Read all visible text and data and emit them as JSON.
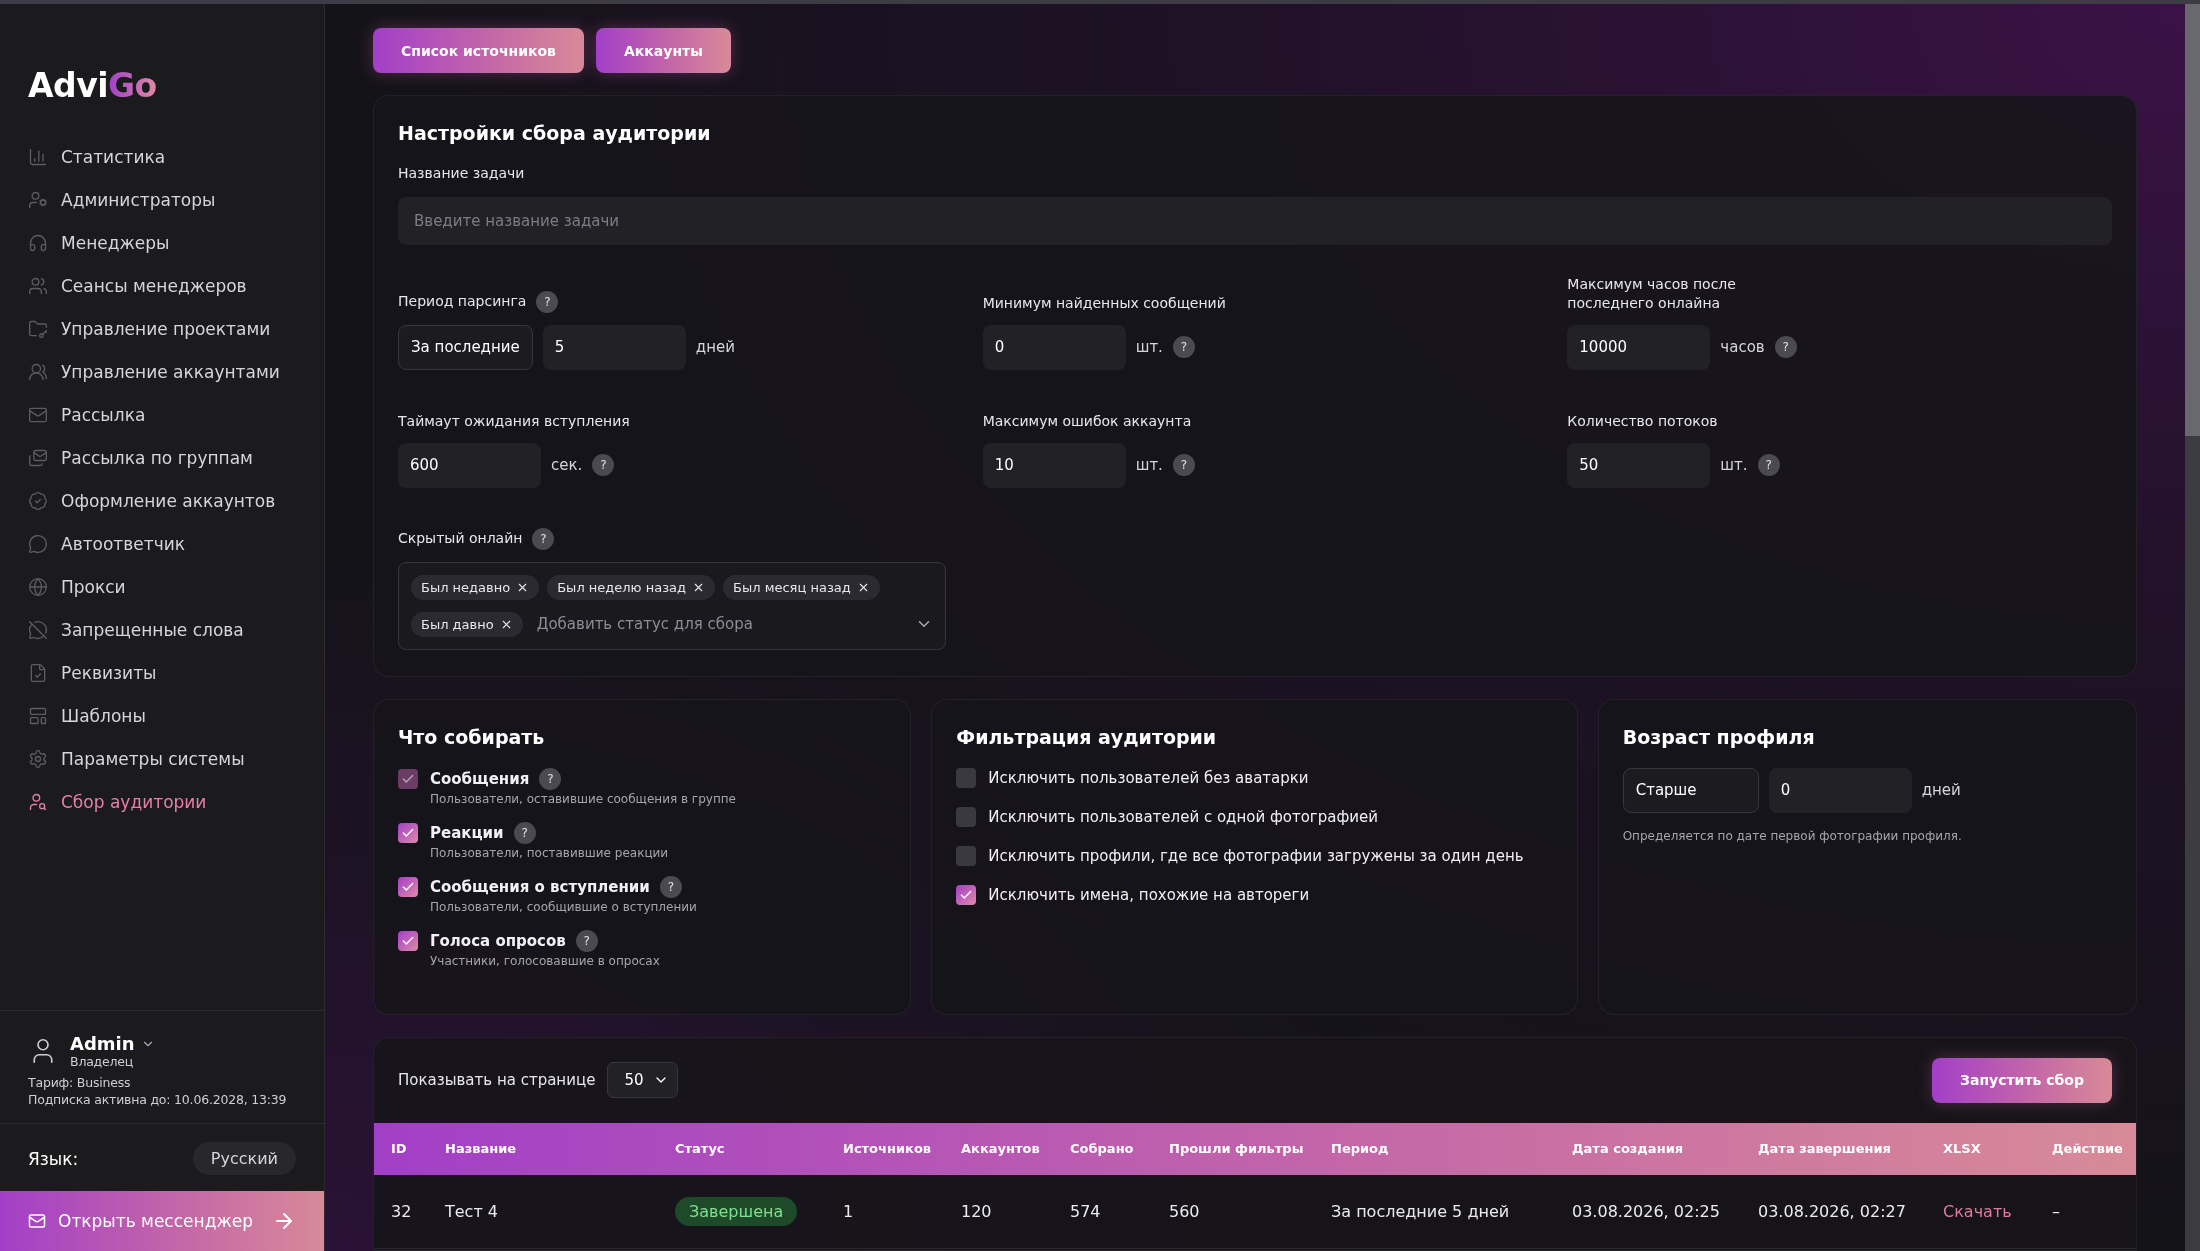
{
  "sidebar": {
    "logo": {
      "text": "Advi",
      "accent": "Go"
    },
    "items": [
      {
        "label": "Статистика",
        "selected": false
      },
      {
        "label": "Администраторы",
        "selected": false
      },
      {
        "label": "Менеджеры",
        "selected": false
      },
      {
        "label": "Сеансы менеджеров",
        "selected": false
      },
      {
        "label": "Управление проектами",
        "selected": false
      },
      {
        "label": "Управление аккаунтами",
        "selected": false
      },
      {
        "label": "Рассылка",
        "selected": false
      },
      {
        "label": "Рассылка по группам",
        "selected": false
      },
      {
        "label": "Оформление аккаунтов",
        "selected": false
      },
      {
        "label": "Автоответчик",
        "selected": false
      },
      {
        "label": "Прокси",
        "selected": false
      },
      {
        "label": "Запрещенные слова",
        "selected": false
      },
      {
        "label": "Реквизиты",
        "selected": false
      },
      {
        "label": "Шаблоны",
        "selected": false
      },
      {
        "label": "Параметры системы",
        "selected": false
      },
      {
        "label": "Сбор аудитории",
        "selected": true
      }
    ],
    "user": {
      "name": "Admin",
      "role": "Владелец",
      "plan": "Тариф: Business",
      "subscription": "Подписка активна до: 10.06.2028, 13:39"
    },
    "language": {
      "label": "Язык:",
      "value": "Русский"
    },
    "messenger_button": "Открыть мессенджер"
  },
  "top_buttons": [
    "Список источников",
    "Аккаунты"
  ],
  "settings": {
    "title": "Настройки сбора аудитории",
    "task_name": {
      "label": "Название задачи",
      "placeholder": "Введите название задачи"
    },
    "fields": [
      {
        "kind": "period",
        "label": "Период парсинга",
        "help": "?",
        "select": "За последние",
        "value": "5",
        "unit": "дней"
      },
      {
        "kind": "number",
        "label": "Минимум найденных сообщений",
        "value": "0",
        "unit": "шт.",
        "help": "?"
      },
      {
        "kind": "number",
        "label": "Максимум часов после последнего онлайна",
        "value": "10000",
        "unit": "часов",
        "help": "?"
      },
      {
        "kind": "number",
        "label": "Таймаут ожидания вступления",
        "value": "600",
        "unit": "сек.",
        "help": "?"
      },
      {
        "kind": "number",
        "label": "Максимум ошибок аккаунта",
        "value": "10",
        "unit": "шт.",
        "help": "?"
      },
      {
        "kind": "number",
        "label": "Количество потоков",
        "value": "50",
        "unit": "шт.",
        "help": "?"
      }
    ],
    "hidden_online": {
      "label": "Скрытый онлайн",
      "help": "?",
      "tags": [
        "Был недавно",
        "Был неделю назад",
        "Был месяц назад",
        "Был давно"
      ],
      "placeholder": "Добавить статус для сбора"
    }
  },
  "collect": {
    "title": "Что собирать",
    "options": [
      {
        "label": "Сообщения",
        "help": "?",
        "description": "Пользователи, оставившие сообщения в группе",
        "checked": true,
        "disabled": true
      },
      {
        "label": "Реакции",
        "help": "?",
        "description": "Пользователи, поставившие реакции",
        "checked": true,
        "disabled": false
      },
      {
        "label": "Сообщения о вступлении",
        "help": "?",
        "description": "Пользователи, сообщившие о вступлении",
        "checked": true,
        "disabled": false
      },
      {
        "label": "Голоса опросов",
        "help": "?",
        "description": "Участники, голосовавшие в опросах",
        "checked": true,
        "disabled": false
      }
    ]
  },
  "filters": {
    "title": "Фильтрация аудитории",
    "options": [
      {
        "label": "Исключить пользователей без аватарки",
        "checked": false
      },
      {
        "label": "Исключить пользователей с одной фотографией",
        "checked": false
      },
      {
        "label": "Исключить профили, где все фотографии загружены за один день",
        "checked": false
      },
      {
        "label": "Исключить имена, похожие на автореги",
        "checked": true
      }
    ]
  },
  "profile_age": {
    "title": "Возраст профиля",
    "select": "Старше",
    "value": "0",
    "unit": "дней",
    "note": "Определяется по дате первой фотографии профиля."
  },
  "tasks": {
    "page_size_label": "Показывать на странице",
    "page_size": "50",
    "start_button": "Запустить сбор",
    "columns": [
      "ID",
      "Название",
      "Статус",
      "Источников",
      "Аккаунтов",
      "Собрано",
      "Прошли фильтры",
      "Период",
      "Дата создания",
      "Дата завершения",
      "XLSX",
      "Действие"
    ],
    "rows": [
      {
        "id": "32",
        "name": "Тест 4",
        "status": {
          "text": "Завершена",
          "kind": "done"
        },
        "sources": "1",
        "accounts": "120",
        "collected": "574",
        "passed": "560",
        "period": "За последние 5 дней",
        "created": "03.08.2026, 02:25",
        "finished": "03.08.2026, 02:27",
        "xlsx": "Скачать",
        "action": "–"
      }
    ]
  }
}
